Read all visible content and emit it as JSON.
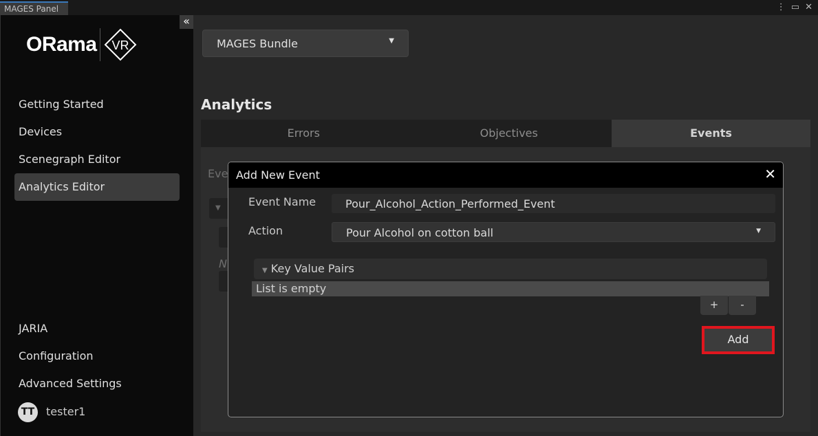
{
  "window": {
    "tab_title": "MAGES Panel",
    "menu_icon": "kebab-icon",
    "maximize_icon": "maximize-icon",
    "close_icon": "close-icon"
  },
  "sidebar": {
    "collapse_icon": "«",
    "logo": {
      "brand": "ORama",
      "mark": "VR"
    },
    "top_items": [
      {
        "label": "Getting Started"
      },
      {
        "label": "Devices"
      },
      {
        "label": "Scenegraph Editor"
      },
      {
        "label": "Analytics Editor",
        "active": true
      }
    ],
    "bottom_items": [
      {
        "label": "JARIA"
      },
      {
        "label": "Configuration"
      },
      {
        "label": "Advanced Settings"
      }
    ],
    "user": {
      "initials": "TT",
      "name": "tester1"
    }
  },
  "main": {
    "bundle_select": {
      "value": "MAGES Bundle"
    },
    "section_title": "Analytics",
    "tabs": [
      {
        "label": "Errors"
      },
      {
        "label": "Objectives"
      },
      {
        "label": "Events",
        "active": true
      }
    ],
    "background": {
      "label_partial": "Eve",
      "italic_partial": "N"
    }
  },
  "modal": {
    "title": "Add New Event",
    "close": "✕",
    "event_name_label": "Event Name",
    "event_name_value": "Pour_Alcohol_Action_Performed_Event",
    "action_label": "Action",
    "action_value": "Pour Alcohol on cotton ball",
    "kv_label": "Key Value Pairs",
    "list_empty": "List is empty",
    "plus": "+",
    "minus": "-",
    "add_label": "Add",
    "highlight_color": "#e0161e"
  }
}
